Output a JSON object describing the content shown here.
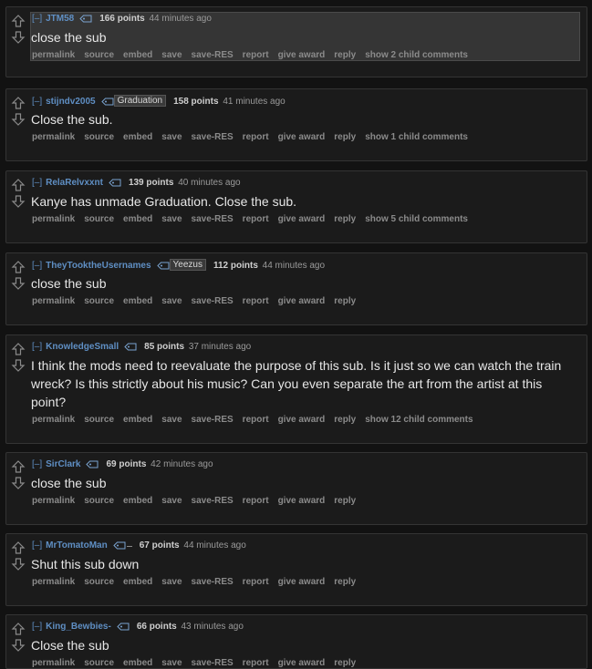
{
  "actions": [
    "permalink",
    "source",
    "embed",
    "save",
    "save-RES",
    "report",
    "give award",
    "reply"
  ],
  "comments": [
    {
      "author": "JTM58",
      "flair": "",
      "score": "166 points",
      "time": "44 minutes ago",
      "text": "close the sub",
      "children": "show 2 child comments"
    },
    {
      "author": "stijndv2005",
      "flair": "Graduation",
      "score": "158 points",
      "time": "41 minutes ago",
      "text": "Close the sub.",
      "children": "show 1 child comments"
    },
    {
      "author": "RelaRelvxxnt",
      "flair": "",
      "score": "139 points",
      "time": "40 minutes ago",
      "text": "Kanye has unmade Graduation. Close the sub.",
      "children": "show 5 child comments"
    },
    {
      "author": "TheyTooktheUsernames",
      "flair": "Yeezus",
      "score": "112 points",
      "time": "44 minutes ago",
      "text": "close the sub",
      "children": ""
    },
    {
      "author": "KnowledgeSmall",
      "flair": "",
      "score": "85 points",
      "time": "37 minutes ago",
      "text": "I think the mods need to reevaluate the purpose of this sub. Is it just so we can watch the train wreck? Is this strictly about his music? Can you even separate the art from the artist at this point?",
      "children": "show 12 child comments"
    },
    {
      "author": "SirClark",
      "flair": "",
      "score": "69 points",
      "time": "42 minutes ago",
      "text": "close the sub",
      "children": ""
    },
    {
      "author": "MrTomatoMan",
      "flair": "",
      "score": "67 points",
      "time": "44 minutes ago",
      "text": "Shut this sub down",
      "children": ""
    },
    {
      "author": "King_Bewbies-",
      "flair": "",
      "score": "66 points",
      "time": "43 minutes ago",
      "text": "Close the sub",
      "children": ""
    }
  ],
  "collapse_label": "[–]"
}
